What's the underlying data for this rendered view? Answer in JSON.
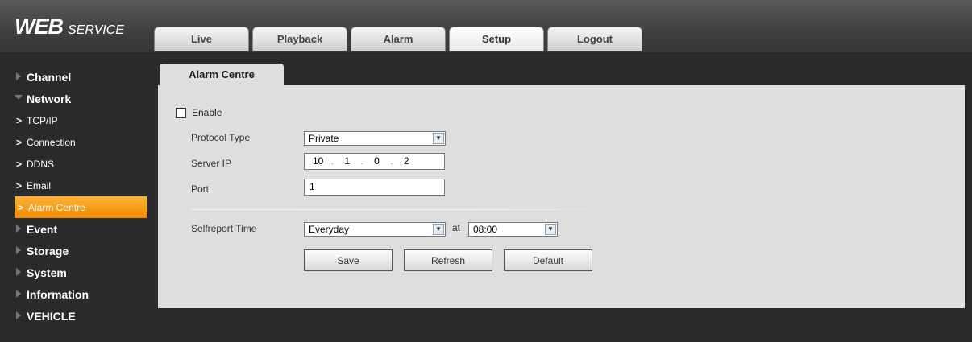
{
  "logo": {
    "big": "WEB",
    "small": "SERVICE"
  },
  "tabs": [
    {
      "label": "Live"
    },
    {
      "label": "Playback"
    },
    {
      "label": "Alarm"
    },
    {
      "label": "Setup",
      "active": true
    },
    {
      "label": "Logout"
    }
  ],
  "sidebar": {
    "channel": "Channel",
    "network": "Network",
    "network_items": [
      "TCP/IP",
      "Connection",
      "DDNS",
      "Email",
      "Alarm Centre"
    ],
    "event": "Event",
    "storage": "Storage",
    "system": "System",
    "information": "Information",
    "vehicle": "VEHICLE",
    "chevron": ">"
  },
  "page": {
    "subtab": "Alarm Centre",
    "enable_label": "Enable",
    "enable_checked": false,
    "protocol_label": "Protocol Type",
    "protocol_value": "Private",
    "server_ip_label": "Server IP",
    "server_ip": [
      "10",
      "1",
      "0",
      "2"
    ],
    "ip_dot": ".",
    "port_label": "Port",
    "port_value": "1",
    "selfreport_label": "Selfreport Time",
    "selfreport_value": "Everyday",
    "at_label": "at",
    "time_value": "08:00",
    "save": "Save",
    "refresh": "Refresh",
    "default": "Default"
  },
  "colors": {
    "accent": "#f59a10",
    "panel": "#dedede",
    "background": "#2b2b2b"
  }
}
